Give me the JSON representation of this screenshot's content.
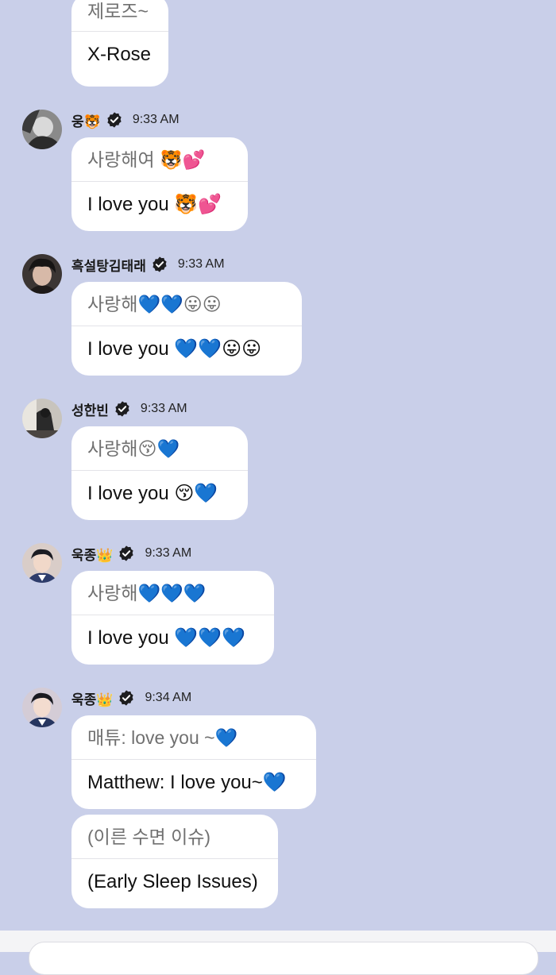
{
  "colors": {
    "background": "#c9cfe9",
    "bubble": "#ffffff",
    "verified_badge": "#1d1d1f"
  },
  "messages": [
    {
      "sender": "",
      "time": "",
      "bubbles": [
        {
          "original": "제로즈~",
          "translation": "X-Rose"
        }
      ]
    },
    {
      "sender": "웅🐯",
      "verified": true,
      "time": "9:33 AM",
      "bubbles": [
        {
          "original": "사랑해여 🐯💕",
          "translation": "I love you 🐯💕"
        }
      ]
    },
    {
      "sender": "흑설탕김태래",
      "verified": true,
      "time": "9:33 AM",
      "bubbles": [
        {
          "original": "사랑해💙💙😛😛",
          "translation": "I love you 💙💙😛😛"
        }
      ]
    },
    {
      "sender": "성한빈",
      "verified": true,
      "time": "9:33 AM",
      "bubbles": [
        {
          "original": "사랑해😚💙",
          "translation": "I love you 😚💙"
        }
      ]
    },
    {
      "sender": "욱종👑",
      "verified": true,
      "time": "9:33 AM",
      "bubbles": [
        {
          "original": "사랑해💙💙💙",
          "translation": "I love you 💙💙💙"
        }
      ]
    },
    {
      "sender": "욱종👑",
      "verified": true,
      "time": "9:34 AM",
      "bubbles": [
        {
          "original": "매튜: love you ~💙",
          "translation": "Matthew: I love you~💙"
        },
        {
          "original": "(이른 수면 이슈)",
          "translation": "(Early Sleep Issues)"
        }
      ]
    }
  ]
}
